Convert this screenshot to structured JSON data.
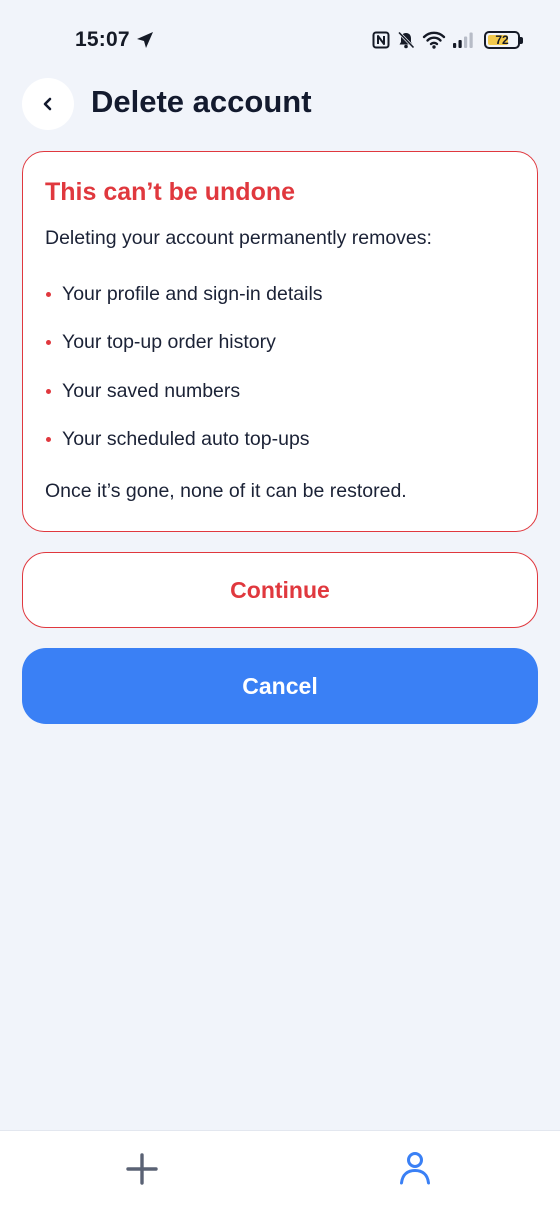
{
  "status_bar": {
    "time": "15:07",
    "battery_level": "72",
    "icons": [
      "navigation-arrow-icon",
      "nfc-icon",
      "bell-muted-icon",
      "wifi-icon",
      "signal-icon",
      "battery-icon"
    ]
  },
  "header": {
    "back_icon": "chevron-left-icon",
    "title": "Delete account"
  },
  "warning": {
    "title": "This can’t be undone",
    "intro": "Deleting your account permanently removes:",
    "items": [
      "Your profile and sign-in details",
      "Your top-up order history",
      "Your saved numbers",
      "Your scheduled auto top-ups"
    ],
    "footer": "Once it’s gone, none of it can be restored."
  },
  "actions": {
    "continue_label": "Continue",
    "cancel_label": "Cancel"
  },
  "tab_bar": {
    "items": [
      {
        "icon": "plus-icon",
        "active": false
      },
      {
        "icon": "profile-icon",
        "active": true
      }
    ]
  },
  "colors": {
    "danger": "#e0383e",
    "primary": "#3a80f5",
    "background": "#f1f4fa",
    "battery_fill": "#f2c94c"
  }
}
